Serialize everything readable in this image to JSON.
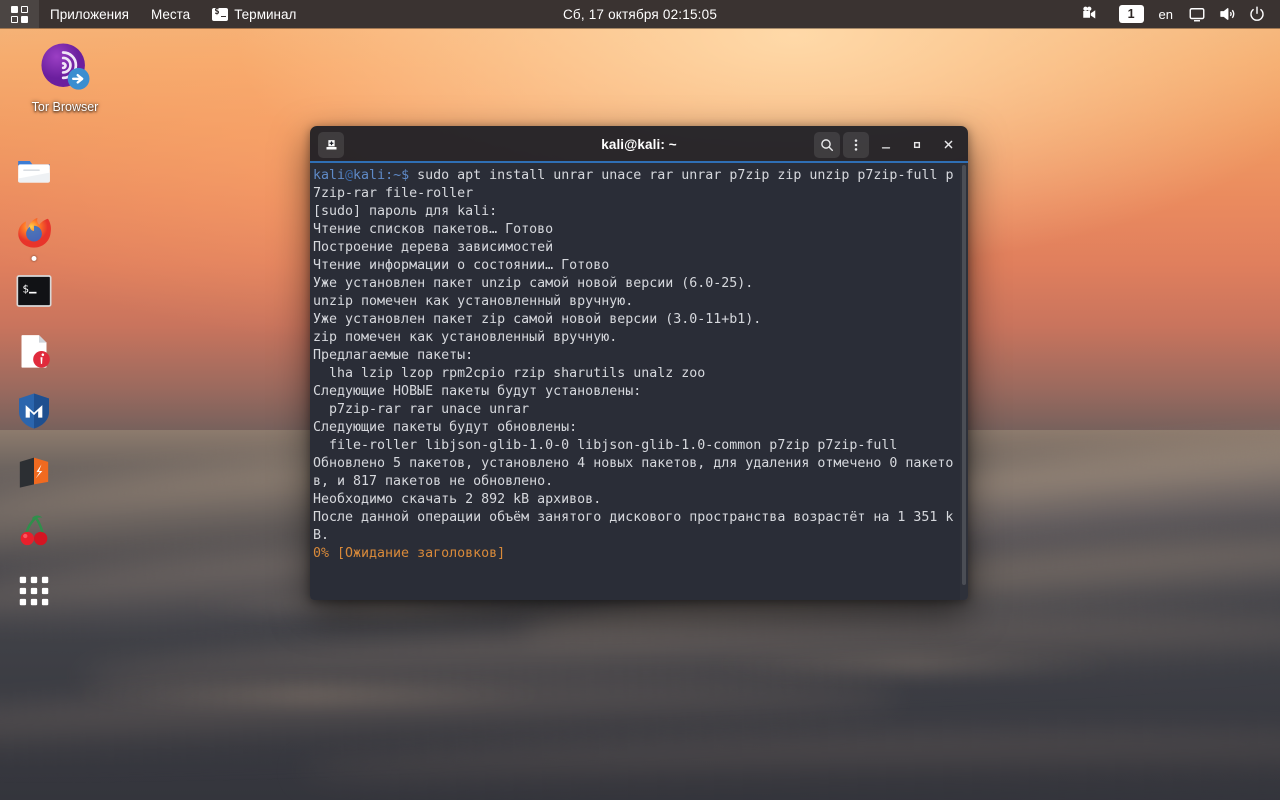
{
  "topbar": {
    "apps_label": "Приложения",
    "places_label": "Места",
    "terminal_label": "Терминал",
    "clock": "Сб, 17 октября  02:15:05",
    "workspace": "1",
    "keyboard_layout": "en",
    "icons": {
      "activities": "grid-icon",
      "terminal": "terminal-icon",
      "screencast": "screencast-icon",
      "display": "display-icon",
      "volume": "volume-icon",
      "power": "power-icon"
    }
  },
  "desktop": {
    "icons": [
      {
        "name": "tor-browser",
        "label": "Tor Browser"
      }
    ]
  },
  "dock": {
    "items": [
      {
        "name": "files",
        "label": "Файлы",
        "running": false
      },
      {
        "name": "firefox",
        "label": "Firefox ESR",
        "running": true
      },
      {
        "name": "terminal",
        "label": "Терминал",
        "running": false
      },
      {
        "name": "text-editor",
        "label": "Текстовый редактор",
        "running": false
      },
      {
        "name": "metasploit",
        "label": "Metasploit",
        "running": false
      },
      {
        "name": "burpsuite",
        "label": "Burp Suite",
        "running": false
      },
      {
        "name": "cherrytree",
        "label": "CherryTree",
        "running": false
      },
      {
        "name": "show-apps",
        "label": "Показать приложения",
        "running": false
      }
    ]
  },
  "terminal": {
    "title": "kali@kali: ~",
    "buttons": {
      "new_tab": "add-tab-icon",
      "search": "search-icon",
      "menu": "menu-icon",
      "minimize": "minimize-icon",
      "maximize": "maximize-icon",
      "close": "close-icon"
    },
    "prompt": {
      "user": "kali",
      "at": "@",
      "host": "kali",
      "path": ":~$",
      "command": " sudo apt install unrar unace rar unrar p7zip zip unzip p7zip-full p"
    },
    "lines": [
      "7zip-rar file-roller",
      "[sudo] пароль для kali:",
      "Чтение списков пакетов… Готово",
      "Построение дерева зависимостей",
      "Чтение информации о состоянии… Готово",
      "Уже установлен пакет unzip самой новой версии (6.0-25).",
      "unzip помечен как установленный вручную.",
      "Уже установлен пакет zip самой новой версии (3.0-11+b1).",
      "zip помечен как установленный вручную.",
      "Предлагаемые пакеты:",
      "  lha lzip lzop rpm2cpio rzip sharutils unalz zoo",
      "Следующие НОВЫЕ пакеты будут установлены:",
      "  p7zip-rar rar unace unrar",
      "Следующие пакеты будут обновлены:",
      "  file-roller libjson-glib-1.0-0 libjson-glib-1.0-common p7zip p7zip-full",
      "Обновлено 5 пакетов, установлено 4 новых пакетов, для удаления отмечено 0 пакето",
      "в, и 817 пакетов не обновлено.",
      "Необходимо скачать 2 892 kB архивов.",
      "После данной операции объём занятого дискового пространства возрастёт на 1 351 k",
      "B."
    ],
    "progress_line": "0% [Ожидание заголовков]",
    "colors": {
      "prompt": "#5f8ac7",
      "progress": "#d98a3a",
      "background": "#2a2d37",
      "titlebar_accent": "#2f6fb5"
    }
  }
}
